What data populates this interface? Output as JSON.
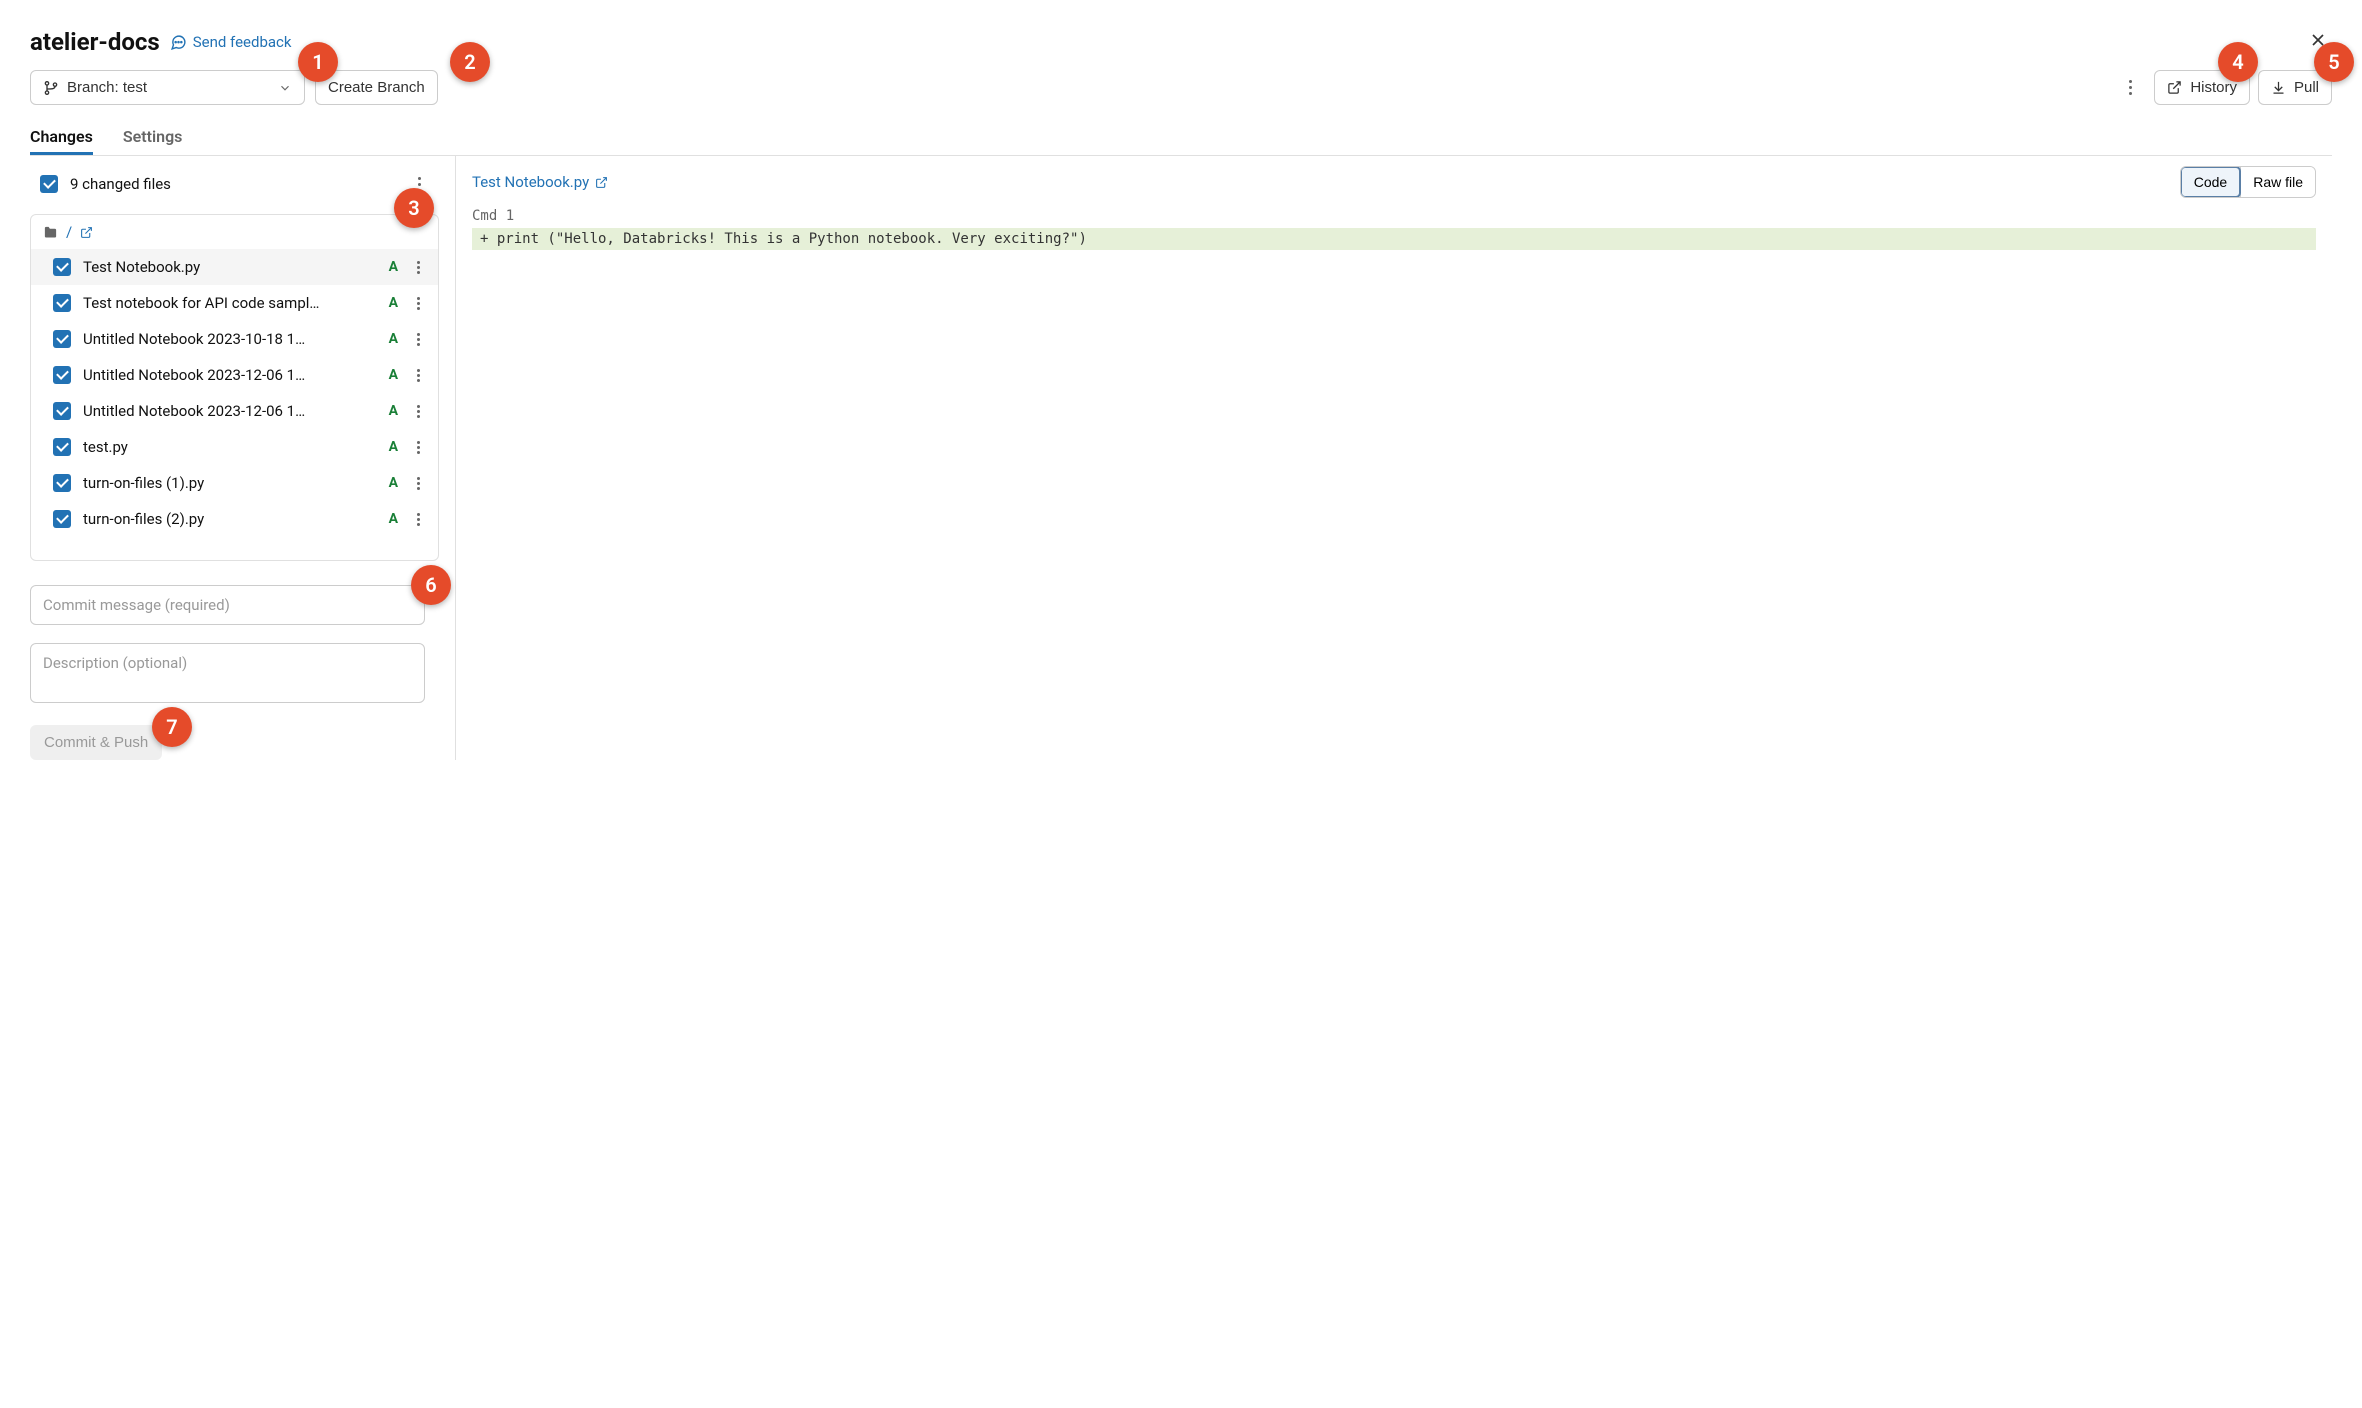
{
  "header": {
    "repo_title": "atelier-docs",
    "feedback_label": "Send feedback"
  },
  "toolbar": {
    "branch_label": "Branch: test",
    "create_branch_label": "Create Branch",
    "history_label": "History",
    "pull_label": "Pull"
  },
  "tabs": {
    "changes": "Changes",
    "settings": "Settings"
  },
  "changes_panel": {
    "count_label": "9 changed files",
    "folder_path": "/",
    "files": [
      {
        "name": "Test Notebook.py",
        "status": "A",
        "selected": true
      },
      {
        "name": "Test notebook for API code sampl…",
        "status": "A",
        "selected": false
      },
      {
        "name": "Untitled Notebook 2023-10-18 1…",
        "status": "A",
        "selected": false
      },
      {
        "name": "Untitled Notebook 2023-12-06 1…",
        "status": "A",
        "selected": false
      },
      {
        "name": "Untitled Notebook 2023-12-06 1…",
        "status": "A",
        "selected": false
      },
      {
        "name": "test.py",
        "status": "A",
        "selected": false
      },
      {
        "name": "turn-on-files (1).py",
        "status": "A",
        "selected": false
      },
      {
        "name": "turn-on-files (2).py",
        "status": "A",
        "selected": false
      }
    ],
    "commit_msg_placeholder": "Commit message (required)",
    "description_placeholder": "Description (optional)",
    "commit_push_label": "Commit & Push"
  },
  "diff_panel": {
    "file_link": "Test Notebook.py",
    "view_code": "Code",
    "view_raw": "Raw file",
    "cmd_label": "Cmd 1",
    "added_line": " + print (\"Hello, Databricks! This is a Python notebook. Very exciting?\")"
  },
  "callouts": {
    "c1": "1",
    "c2": "2",
    "c3": "3",
    "c4": "4",
    "c5": "5",
    "c6": "6",
    "c7": "7"
  }
}
